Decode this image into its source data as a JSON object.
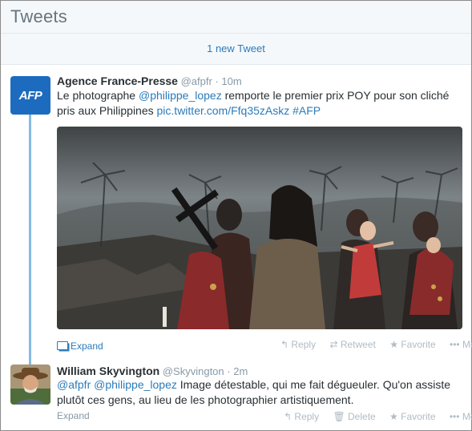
{
  "header": {
    "title": "Tweets"
  },
  "new_tweets": {
    "label": "1 new Tweet"
  },
  "tweets": [
    {
      "avatar_text": "AFP",
      "name": "Agence France-Presse",
      "handle": "@afpfr",
      "separator": "·",
      "time": "10m",
      "text_1": "Le photographe ",
      "mention_1": "@philippe_lopez",
      "text_2": " remporte le premier prix POY pour son cliché pris aux Philippines ",
      "link": "pic.twitter.com/Ffq35zAskz",
      "hashtag": "#AFP",
      "expand_label": "Expand",
      "actions": {
        "reply": "Reply",
        "retweet": "Retweet",
        "favorite": "Favorite",
        "more": "More"
      }
    },
    {
      "name": "William Skyvington",
      "handle": "@Skyvington",
      "separator": "·",
      "time": "2m",
      "mention_1": "@afpfr",
      "mention_2": "@philippe_lopez",
      "text_1": " Image détestable, qui me fait dégueuler. Qu'on assiste plutôt ces gens, au lieu de les photographier artistiquement.",
      "expand_label": "Expand",
      "actions": {
        "reply": "Reply",
        "delete": "Delete",
        "favorite": "Favorite",
        "more": "More"
      }
    }
  ],
  "colors": {
    "link": "#2b7bb9",
    "muted": "#8899a6",
    "thread_line": "#84bbe2",
    "afp_blue": "#1d6bbf"
  }
}
